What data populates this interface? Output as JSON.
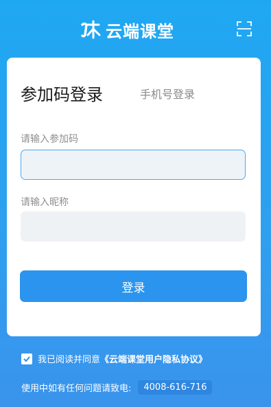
{
  "header": {
    "app_name": "云端课堂",
    "logo_icon": "cloud-classroom-logo-icon",
    "scan_icon": "scan-icon"
  },
  "tabs": {
    "active": "参加码登录",
    "inactive": "手机号登录"
  },
  "form": {
    "code_label": "请输入参加码",
    "code_value": "",
    "nickname_label": "请输入昵称",
    "nickname_value": "",
    "login_button": "登录"
  },
  "agreement": {
    "checked": true,
    "text": "我已阅读并同意",
    "link": "《云端课堂用户隐私协议》"
  },
  "help": {
    "text": "使用中如有任何问题请致电:",
    "phone": "4008-616-716"
  },
  "colors": {
    "brand": "#2b94ee",
    "background_top": "#1fa8f2",
    "card": "#ffffff"
  }
}
